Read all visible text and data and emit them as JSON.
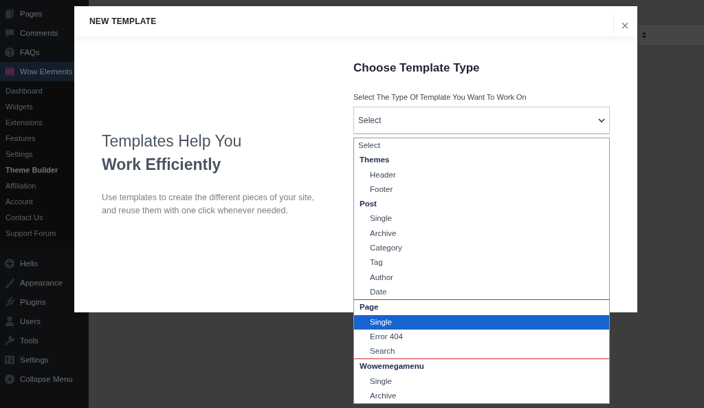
{
  "sidebar": {
    "top_items": [
      {
        "label": "Pages",
        "selected": false
      },
      {
        "label": "Comments",
        "selected": false
      },
      {
        "label": "FAQs",
        "selected": false
      },
      {
        "label": "Wow Elements",
        "selected": true
      }
    ],
    "submenu": [
      {
        "label": "Dashboard",
        "current": false
      },
      {
        "label": "Widgets",
        "current": false
      },
      {
        "label": "Extensions",
        "current": false
      },
      {
        "label": "Features",
        "current": false
      },
      {
        "label": "Settings",
        "current": false
      },
      {
        "label": "Theme Builder",
        "current": true
      },
      {
        "label": "Affiliation",
        "current": false
      },
      {
        "label": "Account",
        "current": false
      },
      {
        "label": "Contact Us",
        "current": false
      },
      {
        "label": "Support Forum",
        "current": false
      }
    ],
    "bottom_items": [
      {
        "label": "Hello",
        "selected": false
      },
      {
        "label": "Appearance",
        "selected": false
      },
      {
        "label": "Plugins",
        "selected": false
      },
      {
        "label": "Users",
        "selected": false
      },
      {
        "label": "Tools",
        "selected": false
      },
      {
        "label": "Settings",
        "selected": false
      },
      {
        "label": "Collapse Menu",
        "selected": false
      }
    ]
  },
  "modal": {
    "title": "NEW TEMPLATE",
    "close": "×",
    "intro": {
      "heading": "Templates Help You",
      "heading_bold": "Work Efficiently",
      "description": "Use templates to create the different pieces of your site, and reuse them with one click whenever needed."
    },
    "form": {
      "heading": "Choose Template Type",
      "label": "Select The Type Of Template You Want To Work On",
      "select": {
        "value": "Select",
        "expanded": true
      },
      "options": [
        {
          "kind": "option",
          "label": "Select",
          "selected": false
        },
        {
          "kind": "group",
          "label": "Themes",
          "highlighted": false,
          "options": [
            {
              "label": "Header",
              "selected": false
            },
            {
              "label": "Footer",
              "selected": false
            }
          ]
        },
        {
          "kind": "group",
          "label": "Post",
          "highlighted": false,
          "options": [
            {
              "label": "Single",
              "selected": false
            },
            {
              "label": "Archive",
              "selected": false
            },
            {
              "label": "Category",
              "selected": false
            },
            {
              "label": "Tag",
              "selected": false
            },
            {
              "label": "Author",
              "selected": false
            },
            {
              "label": "Date",
              "selected": false
            }
          ]
        },
        {
          "kind": "group",
          "label": "Page",
          "highlighted": true,
          "options": [
            {
              "label": "Single",
              "selected": true
            },
            {
              "label": "Error 404",
              "selected": false
            },
            {
              "label": "Search",
              "selected": false
            }
          ]
        },
        {
          "kind": "group",
          "label": "Wowemegamenu",
          "highlighted": false,
          "options": [
            {
              "label": "Single",
              "selected": false
            },
            {
              "label": "Archive",
              "selected": false
            }
          ]
        }
      ]
    }
  }
}
